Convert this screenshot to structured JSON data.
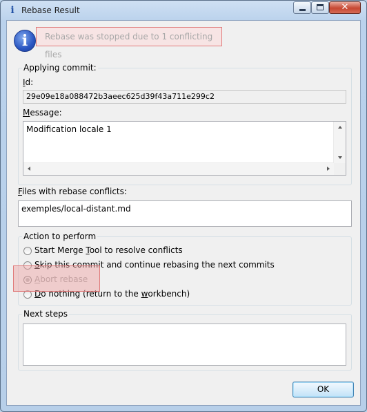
{
  "window": {
    "title": "Rebase Result",
    "close_glyph": "✕"
  },
  "message": "Rebase was stopped due to 1 conflicting files",
  "applying_commit": {
    "group_title": "Applying commit:",
    "id_label": "Id:",
    "id_value": "29e09e18a088472b3aeec625d39f43a711e299c2",
    "message_label": "Message:",
    "message_value": "Modification locale 1"
  },
  "conflicts": {
    "label": "Files with rebase conflicts:",
    "files": [
      "exemples/local-distant.md"
    ]
  },
  "action": {
    "group_title": "Action to perform",
    "options": [
      {
        "label": "Start Merge Tool to resolve conflicts",
        "checked": false,
        "enabled": true
      },
      {
        "label": "Skip this commit and continue rebasing the next commits",
        "checked": false,
        "enabled": true
      },
      {
        "label": "Abort rebase",
        "checked": true,
        "enabled": false
      },
      {
        "label": "Do nothing (return to the workbench)",
        "checked": false,
        "enabled": true
      }
    ]
  },
  "next_steps": {
    "group_title": "Next steps",
    "value": ""
  },
  "buttons": {
    "ok": "OK"
  },
  "icons": {
    "title": "info-icon",
    "message": "info-icon"
  },
  "colors": {
    "highlight": "#e07a7a",
    "disabled_text": "#a3a3a3"
  }
}
